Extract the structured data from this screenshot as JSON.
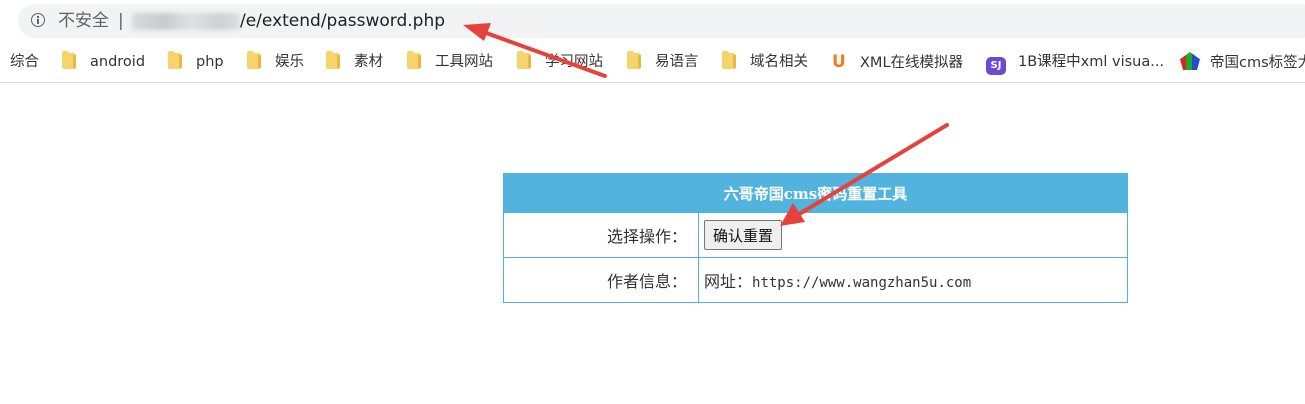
{
  "address_bar": {
    "security_label": "不安全",
    "separator": "|",
    "url_path": "/e/extend/password.php"
  },
  "bookmarks": [
    {
      "label": "综合",
      "icon": "none"
    },
    {
      "label": "android",
      "icon": "folder-icon"
    },
    {
      "label": "php",
      "icon": "folder-icon"
    },
    {
      "label": "娱乐",
      "icon": "folder-icon"
    },
    {
      "label": "素材",
      "icon": "folder-icon"
    },
    {
      "label": "工具网站",
      "icon": "folder-icon"
    },
    {
      "label": "学习网站",
      "icon": "folder-icon"
    },
    {
      "label": "易语言",
      "icon": "folder-icon"
    },
    {
      "label": "域名相关",
      "icon": "folder-icon"
    },
    {
      "label": "XML在线模拟器",
      "icon": "u-logo-icon"
    },
    {
      "label": "1B课程中xml visua...",
      "icon": "sj-logo-icon",
      "icon_text": "SJ"
    },
    {
      "label": "帝国cms标签大",
      "icon": "cms-logo-icon"
    }
  ],
  "tool": {
    "title": "六哥帝国cms密码重置工具",
    "row1_label": "选择操作：",
    "reset_button": "确认重置",
    "row2_label": "作者信息：",
    "author_prefix": "网址：",
    "author_url": "https://www.wangzhan5u.com"
  },
  "colors": {
    "table_header": "#52b3de",
    "table_border": "#4fb3de",
    "arrow": "#e8413c"
  }
}
